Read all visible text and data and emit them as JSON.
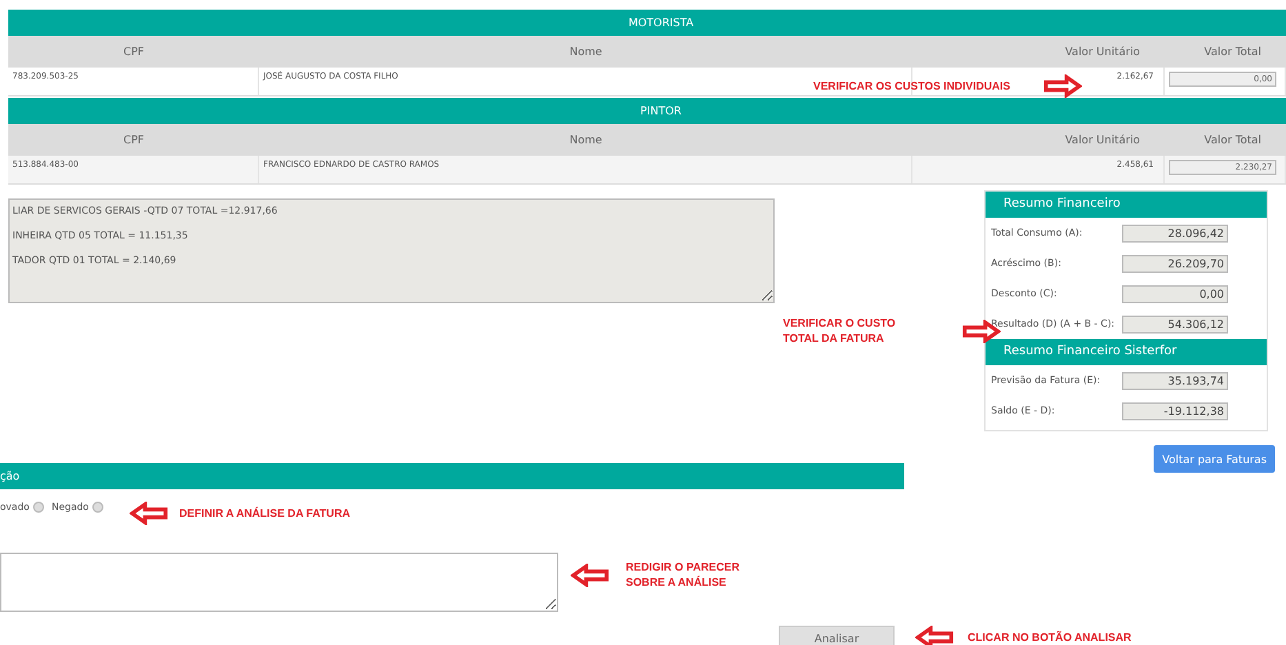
{
  "sections": [
    {
      "title": "MOTORISTA",
      "columns": [
        "CPF",
        "Nome",
        "Valor Unitário",
        "Valor Total"
      ],
      "rows": [
        {
          "cpf": "783.209.503-25",
          "nome": "JOSÉ AUGUSTO DA COSTA FILHO",
          "valor_unitario": "2.162,67",
          "valor_total": "0,00"
        }
      ]
    },
    {
      "title": "PINTOR",
      "columns": [
        "CPF",
        "Nome",
        "Valor Unitário",
        "Valor Total"
      ],
      "rows": [
        {
          "cpf": "513.884.483-00",
          "nome": "FRANCISCO EDNARDO DE CASTRO RAMOS",
          "valor_unitario": "2.458,61",
          "valor_total": "2.230,27"
        }
      ]
    }
  ],
  "summary_text": [
    "LIAR DE SERVICOS GERAIS -QTD 07 TOTAL =12.917,66",
    "INHEIRA QTD 05 TOTAL = 11.151,35",
    "TADOR QTD 01 TOTAL = 2.140,69"
  ],
  "resumo": [
    {
      "title": "Resumo Financeiro",
      "rows": [
        {
          "label": "Total Consumo (A):",
          "value": "28.096,42"
        },
        {
          "label": "Acréscimo (B):",
          "value": "26.209,70"
        },
        {
          "label": "Desconto (C):",
          "value": "0,00"
        },
        {
          "label": "Resultado (D) (A + B - C):",
          "value": "54.306,12"
        }
      ]
    },
    {
      "title": "Resumo Financeiro Sisterfor",
      "rows": [
        {
          "label": "Previsão da Fatura (E):",
          "value": "35.193,74"
        },
        {
          "label": "Saldo (E - D):",
          "value": "-19.112,38"
        }
      ]
    }
  ],
  "back_button": "Voltar para Faturas",
  "approval": {
    "title": "ção",
    "options": [
      {
        "label": "ovado",
        "selected": false
      },
      {
        "label": "Negado",
        "selected": false
      }
    ],
    "submit_button": "Analisar"
  },
  "annotations": [
    {
      "text": "VERIFICAR OS CUSTOS INDIVIDUAIS",
      "kind": "right_arrow"
    },
    {
      "text": "VERIFICAR O CUSTO\nTOTAL DA FATURA",
      "kind": "right_arrow"
    },
    {
      "text": "DEFINIR A ANÁLISE DA FATURA",
      "kind": "left_arrow"
    },
    {
      "text": "REDIGIR O PARECER\nSOBRE A ANÁLISE",
      "kind": "left_arrow"
    },
    {
      "text": "CLICAR NO BOTÃO ANALISAR",
      "kind": "left_arrow"
    }
  ]
}
